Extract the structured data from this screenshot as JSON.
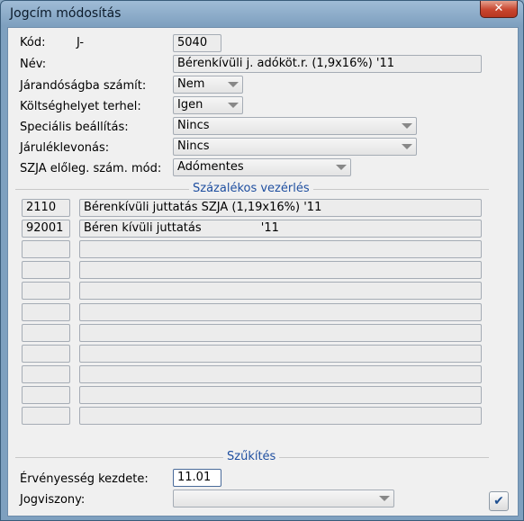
{
  "window": {
    "title": "Jogcím módosítás",
    "close_glyph": "✕"
  },
  "fields": {
    "kod_label": "Kód:",
    "kod_prefix": "J-",
    "kod_value": "5040",
    "nev_label": "Név:",
    "nev_value": "Bérenkívüli j. adóköt.r. (1,9x16%)   '11",
    "jarandosag_label": "Járandóságba számít:",
    "jarandosag_value": "Nem",
    "koltseghely_label": "Költséghelyet terhel:",
    "koltseghely_value": "Igen",
    "specialis_label": "Speciális beállítás:",
    "specialis_value": "Nincs",
    "jarulek_label": "Járuléklevonás:",
    "jarulek_value": "Nincs",
    "szja_label": "SZJA előleg. szám. mód:",
    "szja_value": "Adómentes"
  },
  "szazalekos": {
    "title": "Százalékos vezérlés",
    "rows": [
      {
        "code": "2110",
        "name": "Bérenkívüli juttatás SZJA (1,19x16%) '11"
      },
      {
        "code": "92001",
        "name": "Béren kívüli juttatás                '11"
      },
      {
        "code": "",
        "name": ""
      },
      {
        "code": "",
        "name": ""
      },
      {
        "code": "",
        "name": ""
      },
      {
        "code": "",
        "name": ""
      },
      {
        "code": "",
        "name": ""
      },
      {
        "code": "",
        "name": ""
      },
      {
        "code": "",
        "name": ""
      },
      {
        "code": "",
        "name": ""
      },
      {
        "code": "",
        "name": ""
      }
    ]
  },
  "szukites": {
    "title": "Szűkítés",
    "ervenyesseg_label": "Érvényesség kezdete:",
    "ervenyesseg_value": "11.01",
    "jogviszony_label": "Jogviszony:",
    "jogviszony_value": ""
  },
  "ok_glyph": "✔"
}
